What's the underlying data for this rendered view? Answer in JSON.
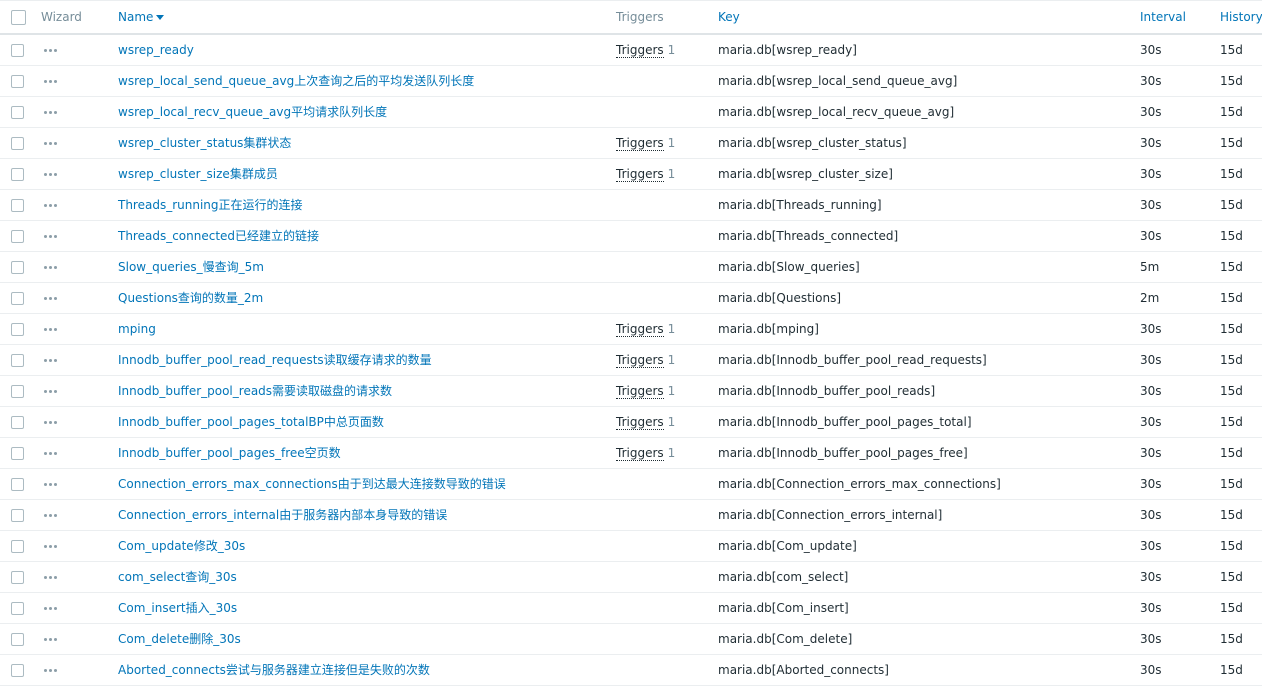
{
  "header": {
    "wizard": "Wizard",
    "name": "Name",
    "triggers": "Triggers",
    "key": "Key",
    "interval": "Interval",
    "history": "History"
  },
  "rows": [
    {
      "name": "wsrep_ready",
      "triggers": "Triggers",
      "trigger_count": "1",
      "key": "maria.db[wsrep_ready]",
      "interval": "30s",
      "history": "15d"
    },
    {
      "name": "wsrep_local_send_queue_avg上次查询之后的平均发送队列长度",
      "triggers": "",
      "trigger_count": "",
      "key": "maria.db[wsrep_local_send_queue_avg]",
      "interval": "30s",
      "history": "15d"
    },
    {
      "name": "wsrep_local_recv_queue_avg平均请求队列长度",
      "triggers": "",
      "trigger_count": "",
      "key": "maria.db[wsrep_local_recv_queue_avg]",
      "interval": "30s",
      "history": "15d"
    },
    {
      "name": "wsrep_cluster_status集群状态",
      "triggers": "Triggers",
      "trigger_count": "1",
      "key": "maria.db[wsrep_cluster_status]",
      "interval": "30s",
      "history": "15d"
    },
    {
      "name": "wsrep_cluster_size集群成员",
      "triggers": "Triggers",
      "trigger_count": "1",
      "key": "maria.db[wsrep_cluster_size]",
      "interval": "30s",
      "history": "15d"
    },
    {
      "name": "Threads_running正在运行的连接",
      "triggers": "",
      "trigger_count": "",
      "key": "maria.db[Threads_running]",
      "interval": "30s",
      "history": "15d"
    },
    {
      "name": "Threads_connected已经建立的链接",
      "triggers": "",
      "trigger_count": "",
      "key": "maria.db[Threads_connected]",
      "interval": "30s",
      "history": "15d"
    },
    {
      "name": "Slow_queries_慢查询_5m",
      "triggers": "",
      "trigger_count": "",
      "key": "maria.db[Slow_queries]",
      "interval": "5m",
      "history": "15d"
    },
    {
      "name": "Questions查询的数量_2m",
      "triggers": "",
      "trigger_count": "",
      "key": "maria.db[Questions]",
      "interval": "2m",
      "history": "15d"
    },
    {
      "name": "mping",
      "triggers": "Triggers",
      "trigger_count": "1",
      "key": "maria.db[mping]",
      "interval": "30s",
      "history": "15d"
    },
    {
      "name": "Innodb_buffer_pool_read_requests读取缓存请求的数量",
      "triggers": "Triggers",
      "trigger_count": "1",
      "key": "maria.db[Innodb_buffer_pool_read_requests]",
      "interval": "30s",
      "history": "15d"
    },
    {
      "name": "Innodb_buffer_pool_reads需要读取磁盘的请求数",
      "triggers": "Triggers",
      "trigger_count": "1",
      "key": "maria.db[Innodb_buffer_pool_reads]",
      "interval": "30s",
      "history": "15d"
    },
    {
      "name": "Innodb_buffer_pool_pages_totalBP中总页面数",
      "triggers": "Triggers",
      "trigger_count": "1",
      "key": "maria.db[Innodb_buffer_pool_pages_total]",
      "interval": "30s",
      "history": "15d"
    },
    {
      "name": "Innodb_buffer_pool_pages_free空页数",
      "triggers": "Triggers",
      "trigger_count": "1",
      "key": "maria.db[Innodb_buffer_pool_pages_free]",
      "interval": "30s",
      "history": "15d"
    },
    {
      "name": "Connection_errors_max_connections由于到达最大连接数导致的错误",
      "triggers": "",
      "trigger_count": "",
      "key": "maria.db[Connection_errors_max_connections]",
      "interval": "30s",
      "history": "15d"
    },
    {
      "name": "Connection_errors_internal由于服务器内部本身导致的错误",
      "triggers": "",
      "trigger_count": "",
      "key": "maria.db[Connection_errors_internal]",
      "interval": "30s",
      "history": "15d"
    },
    {
      "name": "Com_update修改_30s",
      "triggers": "",
      "trigger_count": "",
      "key": "maria.db[Com_update]",
      "interval": "30s",
      "history": "15d"
    },
    {
      "name": "com_select查询_30s",
      "triggers": "",
      "trigger_count": "",
      "key": "maria.db[com_select]",
      "interval": "30s",
      "history": "15d"
    },
    {
      "name": "Com_insert插入_30s",
      "triggers": "",
      "trigger_count": "",
      "key": "maria.db[Com_insert]",
      "interval": "30s",
      "history": "15d"
    },
    {
      "name": "Com_delete删除_30s",
      "triggers": "",
      "trigger_count": "",
      "key": "maria.db[Com_delete]",
      "interval": "30s",
      "history": "15d"
    },
    {
      "name": "Aborted_connects尝试与服务器建立连接但是失败的次数",
      "triggers": "",
      "trigger_count": "",
      "key": "maria.db[Aborted_connects]",
      "interval": "30s",
      "history": "15d"
    }
  ]
}
